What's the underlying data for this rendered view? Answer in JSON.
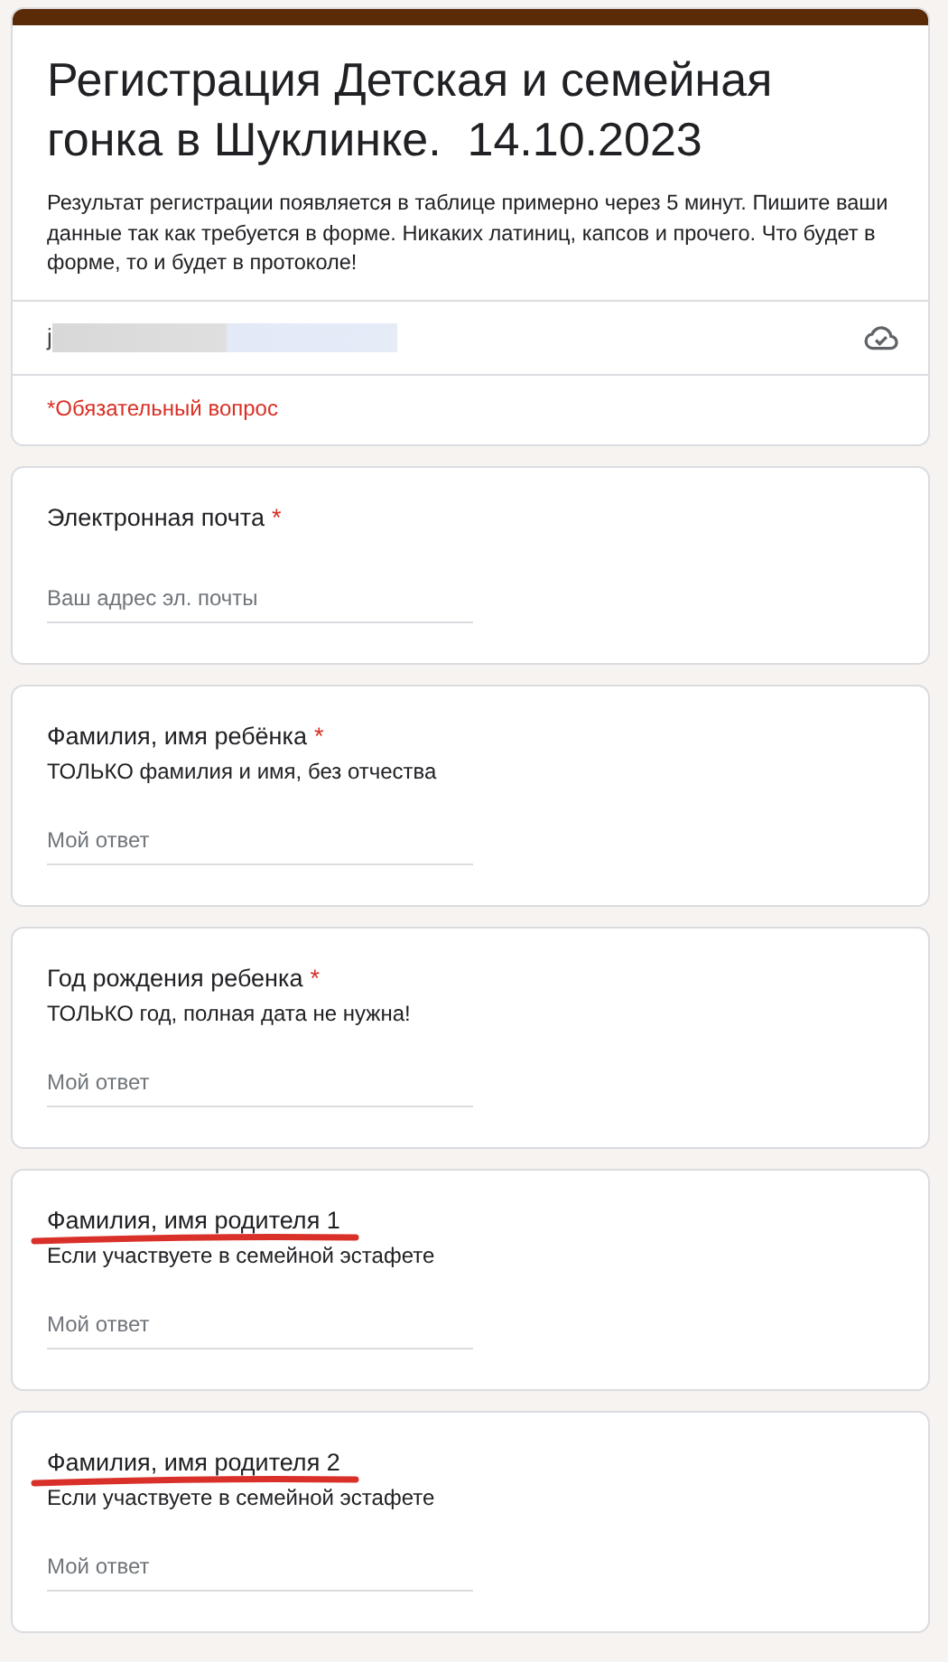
{
  "form": {
    "title": "Регистрация Детская и семейная гонка в Шуклинке.  14.10.2023",
    "description": "Результат регистрации появляется в таблице примерно через 5 минут. Пишите ваши данные так как требуется в форме. Никаких латиниц, капсов и прочего. Что будет в форме, то и будет в протоколе!",
    "account": "j",
    "required_note": "*Обязательный вопрос"
  },
  "questions": [
    {
      "title": "Электронная почта",
      "required_mark": "*",
      "placeholder": "Ваш адрес эл. почты",
      "underlined": false
    },
    {
      "title": "Фамилия, имя ребёнка",
      "required_mark": "*",
      "hint": "ТОЛЬКО фамилия и имя, без отчества",
      "placeholder": "Мой ответ",
      "underlined": false
    },
    {
      "title": "Год рождения ребенка",
      "required_mark": "*",
      "hint": "ТОЛЬКО год, полная дата не нужна!",
      "placeholder": "Мой ответ",
      "underlined": false
    },
    {
      "title": "Фамилия, имя родителя 1",
      "hint": "Если участвуете в семейной эстафете",
      "placeholder": "Мой ответ",
      "underlined": true
    },
    {
      "title": "Фамилия, имя родителя 2",
      "hint": "Если участвуете в семейной эстафете",
      "placeholder": "Мой ответ",
      "underlined": true
    }
  ]
}
